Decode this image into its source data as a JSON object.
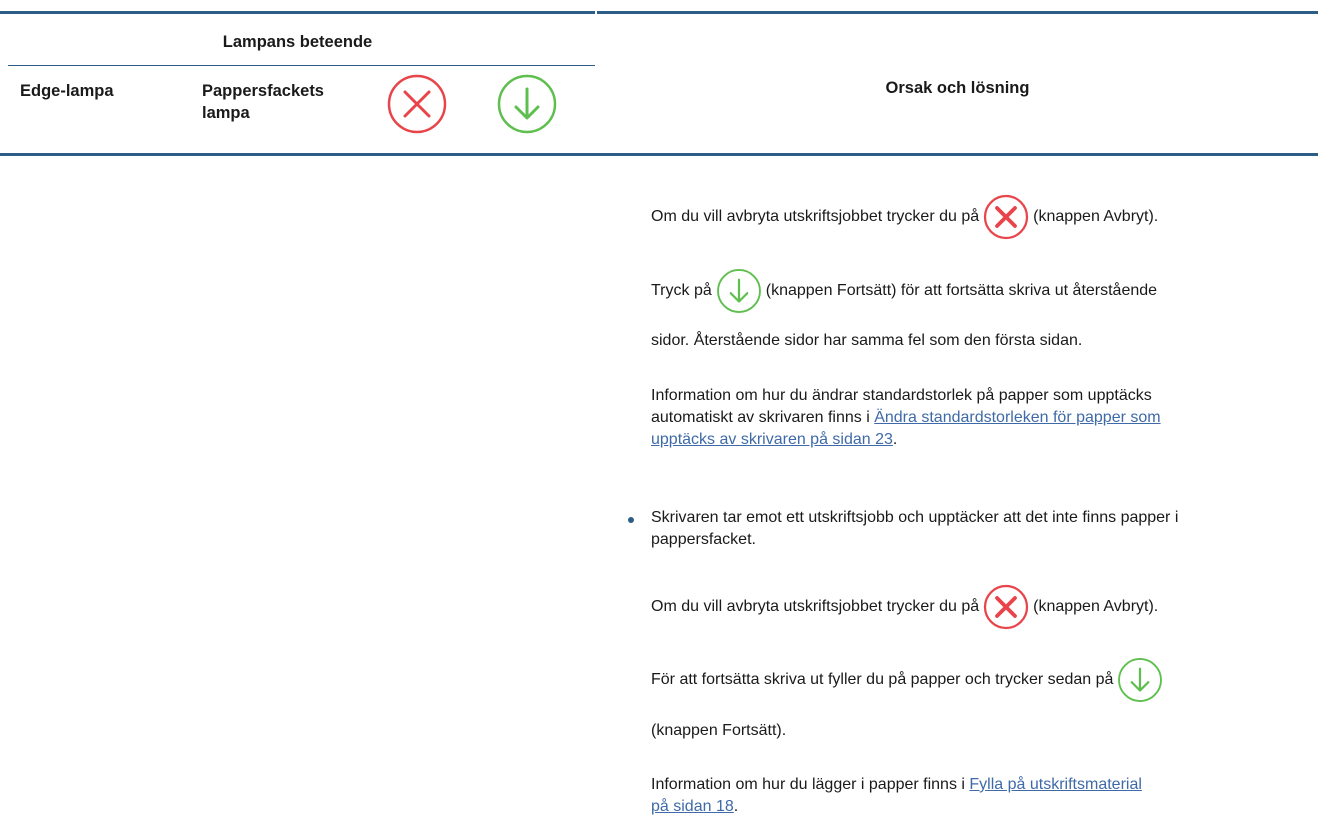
{
  "table": {
    "group_header": "Lampans beteende",
    "col_edge": "Edge-lampa",
    "col_tray_line1": "Pappersfackets",
    "col_tray_line2": "lampa",
    "col_cause": "Orsak och lösning"
  },
  "colors": {
    "rule": "#2b5d87",
    "cancel": "#e8454b",
    "resume": "#5fbf4e",
    "link": "#3f6aa8"
  },
  "icons": {
    "cancel": "cancel-x-icon",
    "resume": "resume-arrow-icon"
  },
  "content": {
    "p1_before": "Om du vill avbryta utskriftsjobbet trycker du på",
    "p1_after": "(knappen Avbryt).",
    "p2_before": "Tryck på",
    "p2_after": "(knappen Fortsätt) för att fortsätta skriva ut återstående",
    "p2_line2": "sidor. Återstående sidor har samma fel som den första sidan.",
    "p3_line1": "Information om hur du ändrar standardstorlek på papper som upptäcks",
    "p3_line2_prefix": "automatiskt av skrivaren finns i ",
    "p3_link_line1": "Ändra standardstorleken för papper som",
    "p3_link_line2": "upptäcks av skrivaren på sidan 23",
    "p3_suffix": ".",
    "bullet_line1": "Skrivaren tar emot ett utskriftsjobb och upptäcker att det inte finns papper i",
    "bullet_line2": "pappersfacket.",
    "p4_before": "Om du vill avbryta utskriftsjobbet trycker du på",
    "p4_after": "(knappen Avbryt).",
    "p5_before": "För att fortsätta skriva ut fyller du på papper och trycker sedan på",
    "p5_line2": "(knappen Fortsätt).",
    "p6_line1_prefix": "Information om hur du lägger i papper finns i ",
    "p6_link_line1": "Fylla på utskriftsmaterial",
    "p6_link_line2": "på sidan 18",
    "p6_suffix": "."
  }
}
